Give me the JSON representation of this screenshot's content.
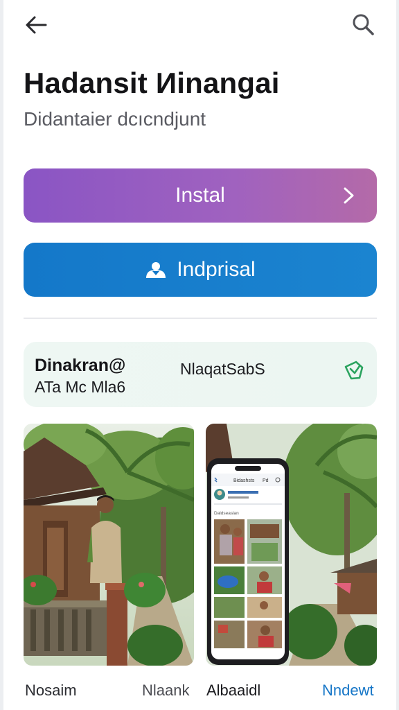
{
  "header": {
    "back_icon": "arrow-left-icon",
    "search_icon": "search-icon"
  },
  "app": {
    "title": "Hadansit Иinangai",
    "subtitle": "Didantaier dcıcndjunt"
  },
  "buttons": {
    "install_label": "Instal",
    "install_icon": "chevron-right-icon",
    "second_label": "Indprisal",
    "second_icon": "person-icon"
  },
  "info_card": {
    "name": "Dinakran@",
    "sub": "ATa Mc Mla6",
    "right_text": "NlaqatSabS",
    "icon": "badge-icon",
    "accent": "#2ba35f"
  },
  "screenshots": {
    "phone_header": "Bidashsts",
    "phone_header_right": "Pd",
    "phone_section": "Daldseaslan"
  },
  "bottom_labels": [
    "Nosaim",
    "Nlaank",
    "Albaaidl",
    "Nndewt"
  ],
  "colors": {
    "install_gradient_start": "#8a55c4",
    "install_gradient_end": "#b46aa8",
    "second_button": "#1478c9",
    "link": "#1676c7"
  }
}
